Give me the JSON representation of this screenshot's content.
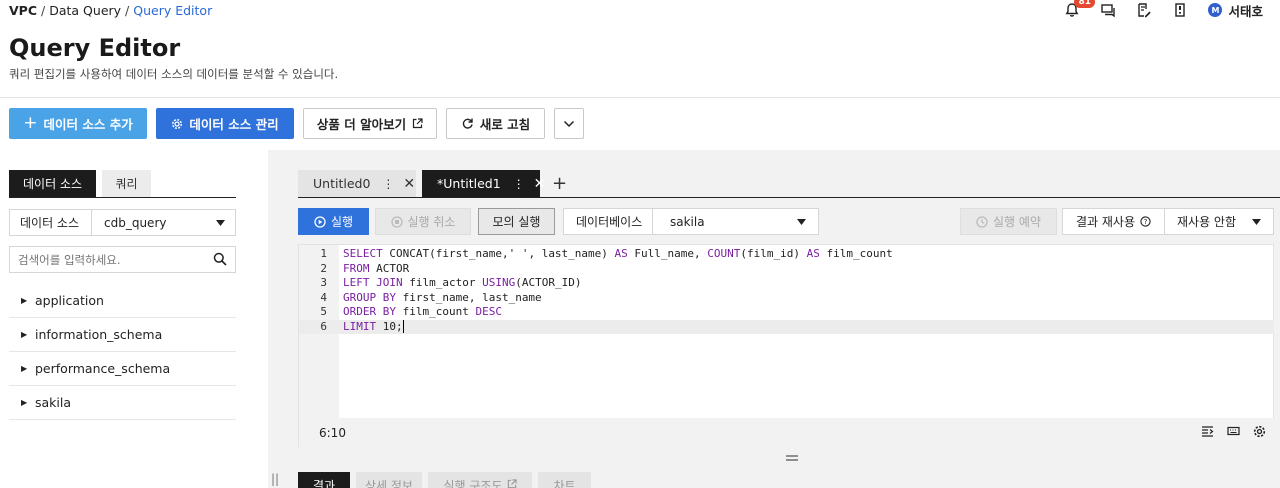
{
  "breadcrumb": {
    "item1": "VPC",
    "item2": "Data Query",
    "item3": "Query Editor",
    "sep": "/"
  },
  "header": {
    "notification_count": "81",
    "user_name": "서태호",
    "avatar_initial": "M"
  },
  "page": {
    "title": "Query Editor",
    "description": "쿼리 편집기를 사용하여 데이터 소스의 데이터를 분석할 수 있습니다."
  },
  "toolbar": {
    "add_source": "데이터 소스 추가",
    "manage_source": "데이터 소스 관리",
    "learn_more": "상품 더 알아보기",
    "refresh": "새로 고침"
  },
  "left": {
    "tabs": [
      "데이터 소스",
      "쿼리"
    ],
    "source_label": "데이터 소스",
    "source_value": "cdb_query",
    "search_placeholder": "검색어를 입력하세요.",
    "tree": [
      "application",
      "information_schema",
      "performance_schema",
      "sakila"
    ]
  },
  "editor_tabs": [
    {
      "label": "Untitled0"
    },
    {
      "label": "*Untitled1"
    }
  ],
  "query_bar": {
    "run": "실행",
    "cancel": "실행 취소",
    "mock": "모의 실행",
    "db_label": "데이터베이스",
    "db_value": "sakila",
    "schedule": "실행 예약",
    "reuse": "결과 재사용",
    "reuse_option": "재사용 안함"
  },
  "editor": {
    "cursor_position": "6:10",
    "lines": [
      "SELECT CONCAT(first_name,' ', last_name) AS Full_name, COUNT(film_id) AS film_count",
      "FROM ACTOR",
      "LEFT JOIN film_actor USING(ACTOR_ID)",
      "GROUP BY first_name, last_name",
      "ORDER BY film_count DESC",
      "LIMIT 10;"
    ]
  },
  "result_tabs": [
    "결과",
    "상세 정보",
    "실행 구조도",
    "차트"
  ],
  "colors": {
    "primary": "#2f72db",
    "light_primary": "#4aa3e6",
    "keyword": "#7a1fa2",
    "badge": "#e5472f"
  }
}
